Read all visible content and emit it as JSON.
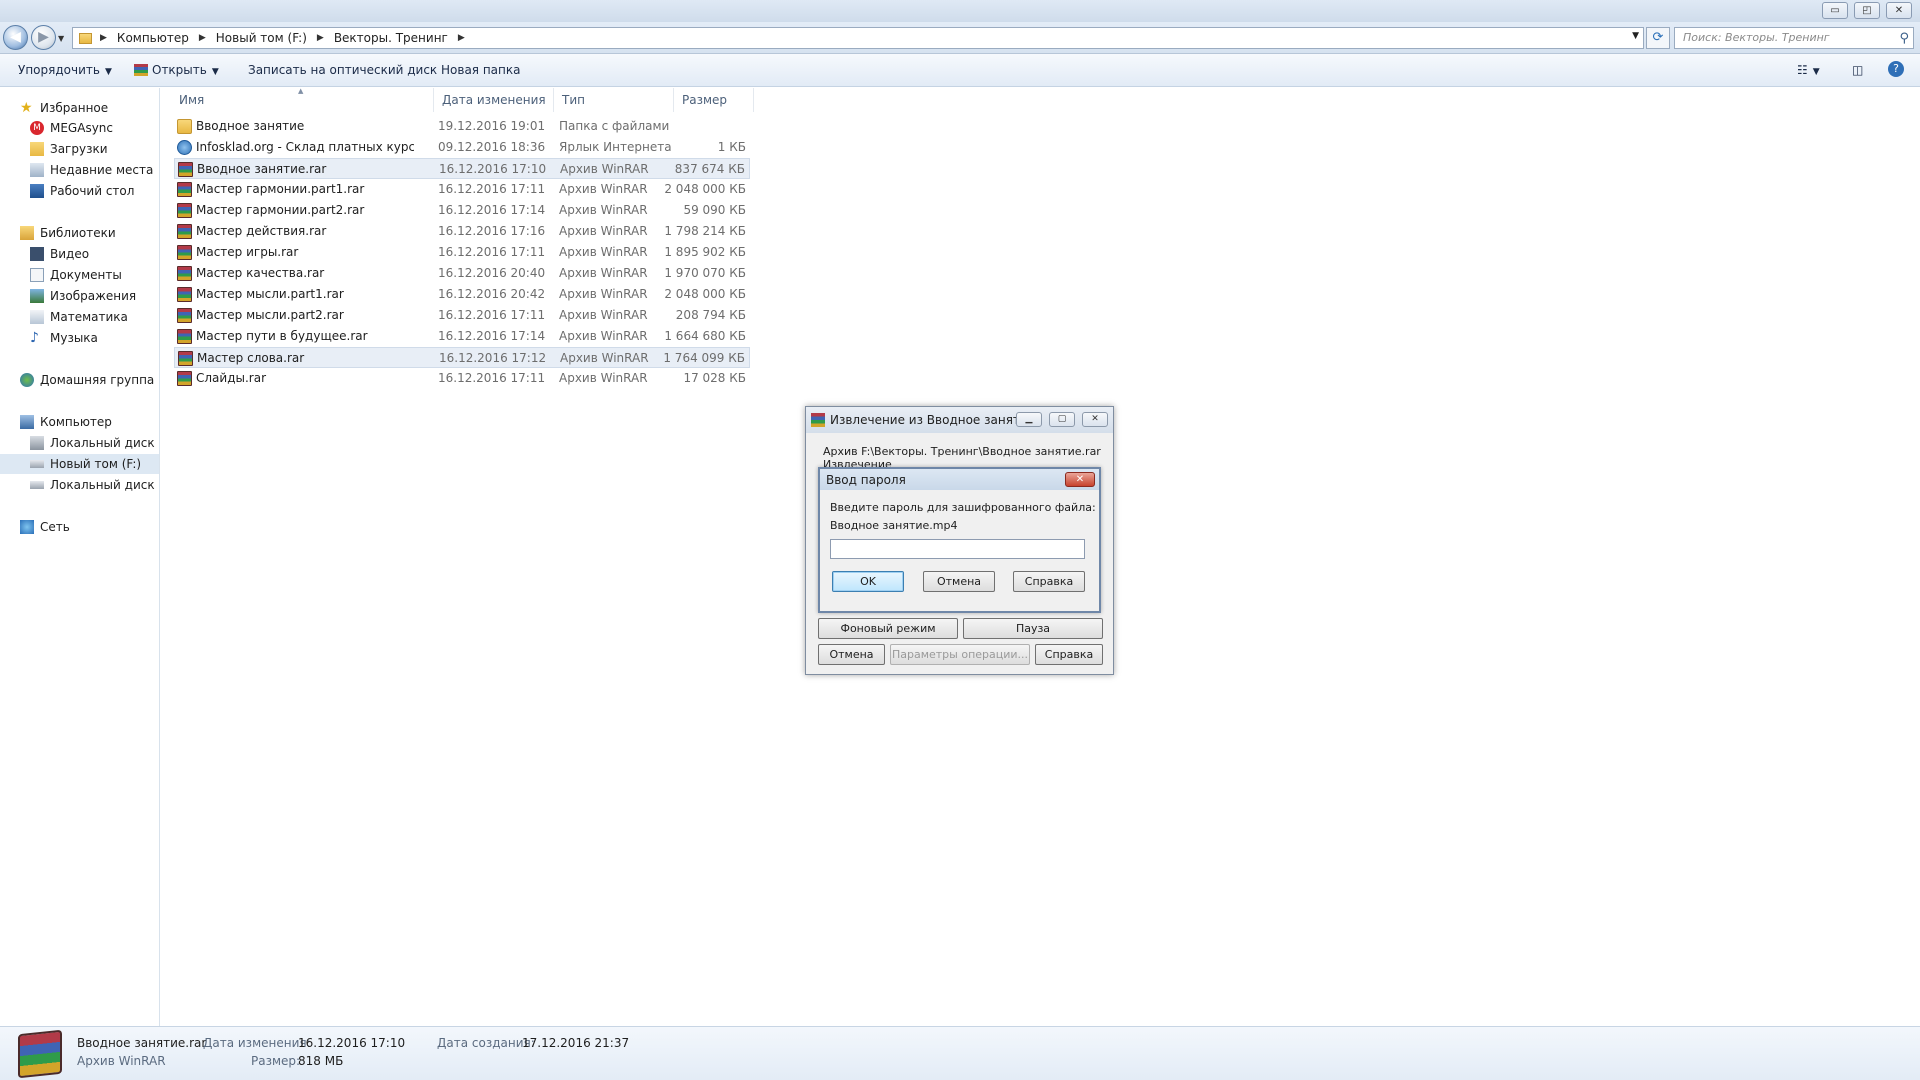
{
  "window": {
    "controls": {
      "minimize": "▭",
      "maximize": "◰",
      "close": "✕"
    }
  },
  "address": {
    "segments": [
      "Компьютер",
      "Новый том (F:)",
      "Векторы. Тренинг"
    ],
    "search_placeholder": "Поиск: Векторы. Тренинг"
  },
  "toolbar": {
    "organize": "Упорядочить",
    "open": "Открыть",
    "burn": "Записать на оптический диск",
    "new_folder": "Новая папка"
  },
  "nav": {
    "favorites": "Избранное",
    "megasync": "MEGAsync",
    "downloads": "Загрузки",
    "recent": "Недавние места",
    "desktop": "Рабочий стол",
    "libraries": "Библиотеки",
    "video": "Видео",
    "documents": "Документы",
    "images": "Изображения",
    "math": "Математика",
    "music": "Музыка",
    "homegroup": "Домашняя группа",
    "computer": "Компьютер",
    "local_c": "Локальный диск (C:",
    "new_volume": "Новый том (F:)",
    "local_n": "Локальный диск (N",
    "network": "Сеть"
  },
  "columns": {
    "name": "Имя",
    "date": "Дата изменения",
    "type": "Тип",
    "size": "Размер"
  },
  "files": [
    {
      "name": "Вводное занятие",
      "date": "19.12.2016 19:01",
      "type": "Папка с файлами",
      "size": "",
      "icon": "folder-icon"
    },
    {
      "name": "Infosklad.org - Склад платных курсов, т...",
      "date": "09.12.2016 18:36",
      "type": "Ярлык Интернета",
      "size": "1 КБ",
      "icon": "link-icon"
    },
    {
      "name": "Вводное занятие.rar",
      "date": "16.12.2016 17:10",
      "type": "Архив WinRAR",
      "size": "837 674 КБ",
      "icon": "rar-icon"
    },
    {
      "name": "Мастер гармонии.part1.rar",
      "date": "16.12.2016 17:11",
      "type": "Архив WinRAR",
      "size": "2 048 000 КБ",
      "icon": "rar-icon"
    },
    {
      "name": "Мастер гармонии.part2.rar",
      "date": "16.12.2016 17:14",
      "type": "Архив WinRAR",
      "size": "59 090 КБ",
      "icon": "rar-icon"
    },
    {
      "name": "Мастер действия.rar",
      "date": "16.12.2016 17:16",
      "type": "Архив WinRAR",
      "size": "1 798 214 КБ",
      "icon": "rar-icon"
    },
    {
      "name": "Мастер игры.rar",
      "date": "16.12.2016 17:11",
      "type": "Архив WinRAR",
      "size": "1 895 902 КБ",
      "icon": "rar-icon"
    },
    {
      "name": "Мастер качества.rar",
      "date": "16.12.2016 20:40",
      "type": "Архив WinRAR",
      "size": "1 970 070 КБ",
      "icon": "rar-icon"
    },
    {
      "name": "Мастер мысли.part1.rar",
      "date": "16.12.2016 20:42",
      "type": "Архив WinRAR",
      "size": "2 048 000 КБ",
      "icon": "rar-icon"
    },
    {
      "name": "Мастер мысли.part2.rar",
      "date": "16.12.2016 17:11",
      "type": "Архив WinRAR",
      "size": "208 794 КБ",
      "icon": "rar-icon"
    },
    {
      "name": "Мастер пути в будущее.rar",
      "date": "16.12.2016 17:14",
      "type": "Архив WinRAR",
      "size": "1 664 680 КБ",
      "icon": "rar-icon"
    },
    {
      "name": "Мастер слова.rar",
      "date": "16.12.2016 17:12",
      "type": "Архив WinRAR",
      "size": "1 764 099 КБ",
      "icon": "rar-icon"
    },
    {
      "name": "Слайды.rar",
      "date": "16.12.2016 17:11",
      "type": "Архив WinRAR",
      "size": "17 028 КБ",
      "icon": "rar-icon"
    }
  ],
  "details": {
    "name": "Вводное занятие.rar",
    "type": "Архив WinRAR",
    "modified_label": "Дата изменения:",
    "modified": "16.12.2016 17:10",
    "size_label": "Размер:",
    "size": "818 МБ",
    "created_label": "Дата создания:",
    "created": "17.12.2016 21:37"
  },
  "extract_dialog": {
    "title": "Извлечение из Вводное заняти...",
    "archive": "Архив F:\\Векторы. Тренинг\\Вводное занятие.rar",
    "status": "Извлечение",
    "background": "Фоновый режим",
    "pause": "Пауза",
    "cancel": "Отмена",
    "options": "Параметры операции...",
    "help": "Справка"
  },
  "password_dialog": {
    "title": "Ввод пароля",
    "prompt": "Введите пароль для зашифрованного файла:",
    "file": "Вводное занятие.mp4",
    "ok": "OK",
    "cancel": "Отмена",
    "help": "Справка"
  }
}
